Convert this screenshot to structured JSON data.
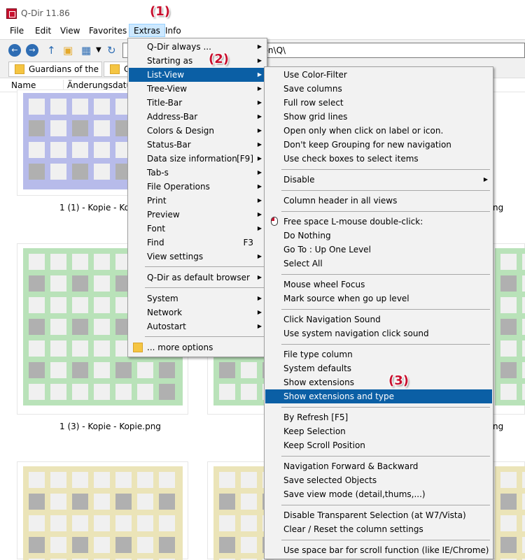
{
  "window": {
    "title": "Q-Dir 11.86"
  },
  "menubar": {
    "items": [
      "File",
      "Edit",
      "View",
      "Favorites",
      "Extras",
      "Info"
    ]
  },
  "toolbar": {
    "address": "g\\icon\\Q\\"
  },
  "tabs": [
    "Guardians of the ...",
    "C"
  ],
  "columns": {
    "name": "Name",
    "date": "Änderungsdatum"
  },
  "thumbnails": {
    "captions": [
      "1 (1) - Kopie - Kopie",
      "1 (3) - Kopie - Kopie.png",
      "ng",
      "ng"
    ],
    "colors": {
      "blue": "#b7bbea",
      "green": "#b9e2b9",
      "yellow": "#ebe4b8"
    }
  },
  "extras_menu": {
    "items": [
      {
        "label": "Q-Dir always ...",
        "has_sub": true
      },
      {
        "label": "Starting as",
        "has_sub": true
      },
      {
        "label": "List-View",
        "has_sub": true,
        "highlighted": true
      },
      {
        "label": "Tree-View",
        "has_sub": true
      },
      {
        "label": "Title-Bar",
        "has_sub": true
      },
      {
        "label": "Address-Bar",
        "has_sub": true
      },
      {
        "label": "Colors & Design",
        "has_sub": true
      },
      {
        "label": "Status-Bar",
        "has_sub": true
      },
      {
        "label": "Data size information",
        "shortcut": "[F9]",
        "has_sub": true
      },
      {
        "label": "Tab-s",
        "has_sub": true
      },
      {
        "label": "File Operations",
        "has_sub": true
      },
      {
        "label": "Print",
        "has_sub": true
      },
      {
        "label": "Preview",
        "has_sub": true
      },
      {
        "label": "Font",
        "has_sub": true
      },
      {
        "label": "Find",
        "shortcut": "F3"
      },
      {
        "label": "View settings",
        "has_sub": true
      },
      {
        "label": "Q-Dir as default browser",
        "has_sub": true
      },
      {
        "label": "System",
        "has_sub": true
      },
      {
        "label": "Network",
        "has_sub": true
      },
      {
        "label": "Autostart",
        "has_sub": true
      },
      {
        "label": "... more options",
        "icon": "folder-icon"
      }
    ]
  },
  "listview_menu": {
    "items": [
      {
        "label": "Use Color-Filter"
      },
      {
        "label": "Save columns"
      },
      {
        "label": "Full row select"
      },
      {
        "label": "Show grid lines"
      },
      {
        "label": "Open only when click on label or icon."
      },
      {
        "label": "Don't keep Grouping for new navigation"
      },
      {
        "label": "Use check boxes to select items"
      },
      {
        "label": "Disable",
        "has_sub": true
      },
      {
        "label": "Column header in all views"
      },
      {
        "label": "Free space L-mouse double-click:",
        "icon": "mouse-icon"
      },
      {
        "label": "Do Nothing"
      },
      {
        "label": "Go To : Up One Level"
      },
      {
        "label": "Select All"
      },
      {
        "label": "Mouse wheel Focus"
      },
      {
        "label": "Mark source when go up level"
      },
      {
        "label": "Click Navigation Sound"
      },
      {
        "label": "Use system navigation click sound"
      },
      {
        "label": "File type column"
      },
      {
        "label": "System defaults"
      },
      {
        "label": "Show extensions"
      },
      {
        "label": "Show extensions and type",
        "highlighted": true
      },
      {
        "label": "By Refresh [F5]"
      },
      {
        "label": "Keep Selection"
      },
      {
        "label": "Keep Scroll Position"
      },
      {
        "label": "Navigation Forward & Backward"
      },
      {
        "label": "Save selected Objects"
      },
      {
        "label": "Save view mode (detail,thums,...)"
      },
      {
        "label": "Disable Transparent Selection (at W7/Vista)"
      },
      {
        "label": "Clear / Reset the column settings"
      },
      {
        "label": "Use space bar for scroll function (like IE/Chrome)"
      }
    ]
  },
  "markers": [
    "(1)",
    "(2)",
    "(3)"
  ],
  "colors": {
    "highlight": "#0b5fa5",
    "marker": "#c8102e",
    "menu_bg": "#f2f2f2"
  }
}
